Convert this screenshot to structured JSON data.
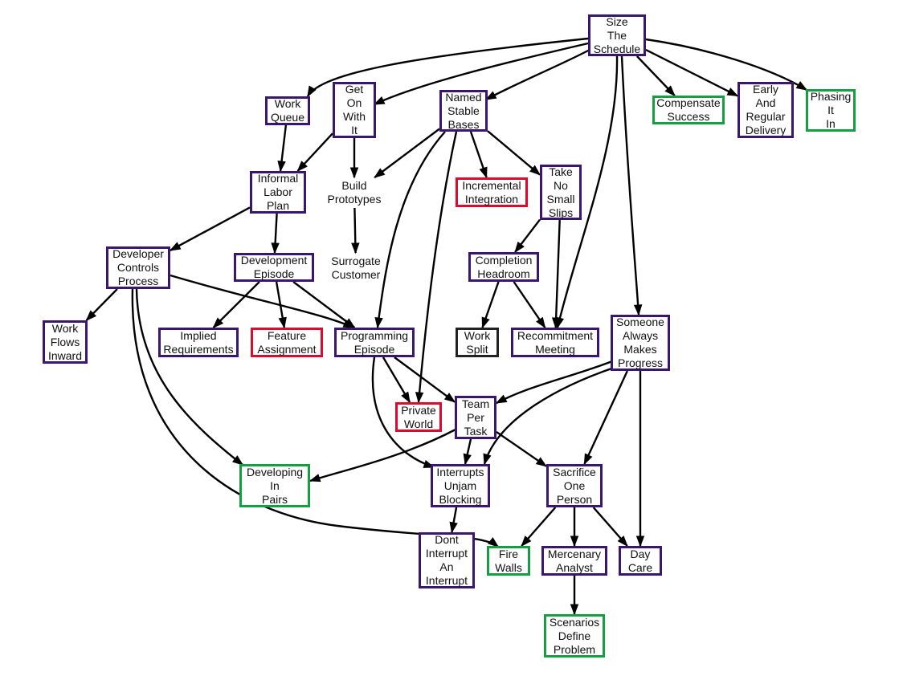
{
  "diagram": {
    "border_colors": {
      "purple": "#3a1670",
      "green": "#14a040",
      "red": "#dd0a2e",
      "black": "#222222"
    },
    "nodes": [
      {
        "id": "size-the-schedule",
        "label": "Size\nThe\nSchedule",
        "border": "purple"
      },
      {
        "id": "work-queue",
        "label": "Work\nQueue",
        "border": "purple"
      },
      {
        "id": "get-on-with-it",
        "label": "Get\nOn\nWith\nIt",
        "border": "purple"
      },
      {
        "id": "named-stable-bases",
        "label": "Named\nStable\nBases",
        "border": "purple"
      },
      {
        "id": "compensate-success",
        "label": "Compensate\nSuccess",
        "border": "green"
      },
      {
        "id": "early-and-regular-delivery",
        "label": "Early\nAnd\nRegular\nDelivery",
        "border": "purple"
      },
      {
        "id": "phasing-it-in",
        "label": "Phasing\nIt\nIn",
        "border": "green"
      },
      {
        "id": "informal-labor-plan",
        "label": "Informal\nLabor\nPlan",
        "border": "purple"
      },
      {
        "id": "build-prototypes",
        "label": "Build\nPrototypes",
        "border": "none"
      },
      {
        "id": "incremental-integration",
        "label": "Incremental\nIntegration",
        "border": "red"
      },
      {
        "id": "take-no-small-slips",
        "label": "Take\nNo\nSmall\nSlips",
        "border": "purple"
      },
      {
        "id": "developer-controls-process",
        "label": "Developer\nControls\nProcess",
        "border": "purple"
      },
      {
        "id": "development-episode",
        "label": "Development\nEpisode",
        "border": "purple"
      },
      {
        "id": "surrogate-customer",
        "label": "Surrogate\nCustomer",
        "border": "none"
      },
      {
        "id": "completion-headroom",
        "label": "Completion\nHeadroom",
        "border": "purple"
      },
      {
        "id": "work-flows-inward",
        "label": "Work\nFlows\nInward",
        "border": "purple"
      },
      {
        "id": "implied-requirements",
        "label": "Implied\nRequirements",
        "border": "purple"
      },
      {
        "id": "feature-assignment",
        "label": "Feature\nAssignment",
        "border": "red"
      },
      {
        "id": "programming-episode",
        "label": "Programming\nEpisode",
        "border": "purple"
      },
      {
        "id": "work-split",
        "label": "Work\nSplit",
        "border": "black"
      },
      {
        "id": "recommitment-meeting",
        "label": "Recommitment\nMeeting",
        "border": "purple"
      },
      {
        "id": "someone-always-makes-progress",
        "label": "Someone\nAlways\nMakes\nProgress",
        "border": "purple"
      },
      {
        "id": "private-world",
        "label": "Private\nWorld",
        "border": "red"
      },
      {
        "id": "team-per-task",
        "label": "Team\nPer\nTask",
        "border": "purple"
      },
      {
        "id": "developing-in-pairs",
        "label": "Developing\nIn\nPairs",
        "border": "green"
      },
      {
        "id": "interrupts-unjam-blocking",
        "label": "Interrupts\nUnjam\nBlocking",
        "border": "purple"
      },
      {
        "id": "sacrifice-one-person",
        "label": "Sacrifice\nOne\nPerson",
        "border": "purple"
      },
      {
        "id": "dont-interrupt-an-interrupt",
        "label": "Dont\nInterrupt\nAn\nInterrupt",
        "border": "purple"
      },
      {
        "id": "fire-walls",
        "label": "Fire\nWalls",
        "border": "green"
      },
      {
        "id": "mercenary-analyst",
        "label": "Mercenary\nAnalyst",
        "border": "purple"
      },
      {
        "id": "day-care",
        "label": "Day\nCare",
        "border": "purple"
      },
      {
        "id": "scenarios-define-problem",
        "label": "Scenarios\nDefine\nProblem",
        "border": "green"
      }
    ],
    "edges": [
      {
        "from": "size-the-schedule",
        "to": "work-queue"
      },
      {
        "from": "size-the-schedule",
        "to": "get-on-with-it"
      },
      {
        "from": "size-the-schedule",
        "to": "named-stable-bases"
      },
      {
        "from": "size-the-schedule",
        "to": "compensate-success"
      },
      {
        "from": "size-the-schedule",
        "to": "early-and-regular-delivery"
      },
      {
        "from": "size-the-schedule",
        "to": "phasing-it-in"
      },
      {
        "from": "size-the-schedule",
        "to": "recommitment-meeting"
      },
      {
        "from": "size-the-schedule",
        "to": "someone-always-makes-progress"
      },
      {
        "from": "work-queue",
        "to": "informal-labor-plan"
      },
      {
        "from": "get-on-with-it",
        "to": "informal-labor-plan"
      },
      {
        "from": "get-on-with-it",
        "to": "build-prototypes"
      },
      {
        "from": "named-stable-bases",
        "to": "build-prototypes"
      },
      {
        "from": "named-stable-bases",
        "to": "incremental-integration"
      },
      {
        "from": "named-stable-bases",
        "to": "take-no-small-slips"
      },
      {
        "from": "named-stable-bases",
        "to": "programming-episode"
      },
      {
        "from": "named-stable-bases",
        "to": "private-world"
      },
      {
        "from": "build-prototypes",
        "to": "surrogate-customer"
      },
      {
        "from": "informal-labor-plan",
        "to": "developer-controls-process"
      },
      {
        "from": "informal-labor-plan",
        "to": "development-episode"
      },
      {
        "from": "take-no-small-slips",
        "to": "completion-headroom"
      },
      {
        "from": "take-no-small-slips",
        "to": "recommitment-meeting"
      },
      {
        "from": "completion-headroom",
        "to": "work-split"
      },
      {
        "from": "completion-headroom",
        "to": "recommitment-meeting"
      },
      {
        "from": "developer-controls-process",
        "to": "work-flows-inward"
      },
      {
        "from": "developer-controls-process",
        "to": "programming-episode"
      },
      {
        "from": "developer-controls-process",
        "to": "developing-in-pairs"
      },
      {
        "from": "developer-controls-process",
        "to": "fire-walls"
      },
      {
        "from": "development-episode",
        "to": "implied-requirements"
      },
      {
        "from": "development-episode",
        "to": "feature-assignment"
      },
      {
        "from": "development-episode",
        "to": "programming-episode"
      },
      {
        "from": "programming-episode",
        "to": "private-world"
      },
      {
        "from": "programming-episode",
        "to": "team-per-task"
      },
      {
        "from": "programming-episode",
        "to": "interrupts-unjam-blocking"
      },
      {
        "from": "someone-always-makes-progress",
        "to": "team-per-task"
      },
      {
        "from": "someone-always-makes-progress",
        "to": "interrupts-unjam-blocking"
      },
      {
        "from": "someone-always-makes-progress",
        "to": "sacrifice-one-person"
      },
      {
        "from": "someone-always-makes-progress",
        "to": "day-care"
      },
      {
        "from": "team-per-task",
        "to": "developing-in-pairs"
      },
      {
        "from": "team-per-task",
        "to": "interrupts-unjam-blocking"
      },
      {
        "from": "team-per-task",
        "to": "sacrifice-one-person"
      },
      {
        "from": "interrupts-unjam-blocking",
        "to": "dont-interrupt-an-interrupt"
      },
      {
        "from": "sacrifice-one-person",
        "to": "fire-walls"
      },
      {
        "from": "sacrifice-one-person",
        "to": "mercenary-analyst"
      },
      {
        "from": "sacrifice-one-person",
        "to": "day-care"
      },
      {
        "from": "mercenary-analyst",
        "to": "scenarios-define-problem"
      }
    ]
  }
}
